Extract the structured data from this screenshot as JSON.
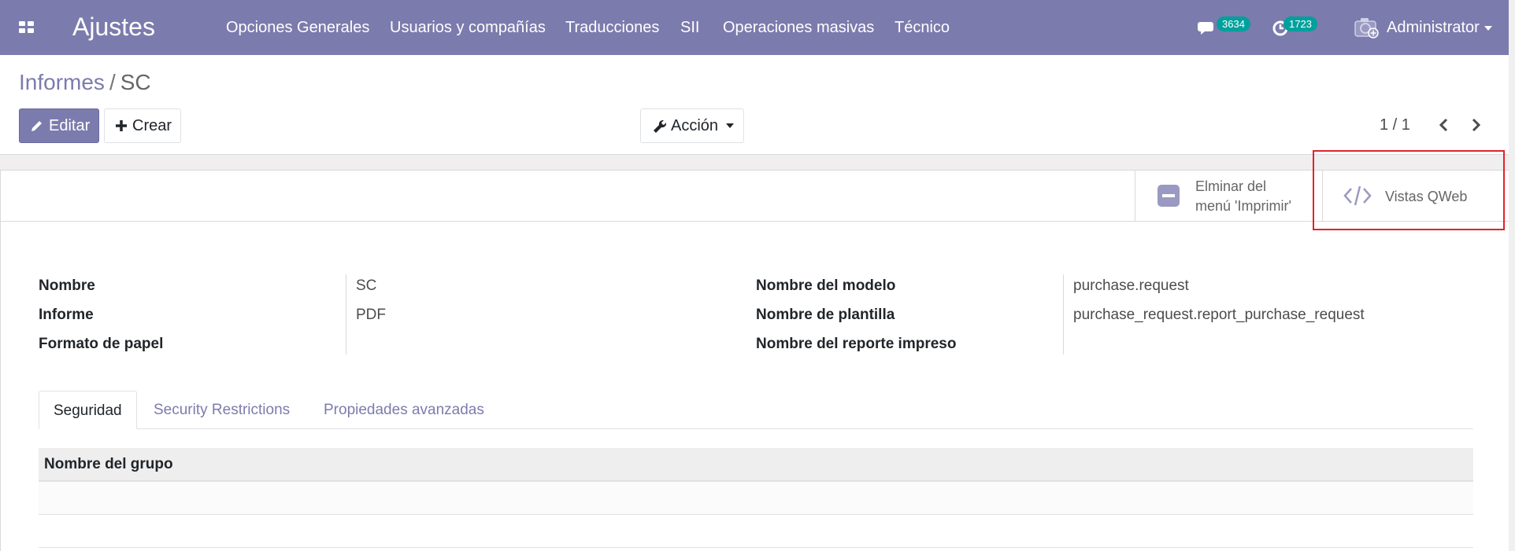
{
  "navbar": {
    "app_title": "Ajustes",
    "menu": [
      "Opciones Generales",
      "Usuarios y compañías",
      "Traducciones",
      "SII",
      "Operaciones masivas",
      "Técnico"
    ],
    "messages_count": "3634",
    "activities_count": "1723",
    "user_name": "Administrator",
    "color": "#7c7bad"
  },
  "breadcrumb": {
    "parent": "Informes",
    "separator": "/",
    "current": "SC"
  },
  "buttons": {
    "edit": "Editar",
    "create": "Crear",
    "action": "Acción"
  },
  "pager": {
    "value": "1 / 1"
  },
  "smart_buttons": {
    "remove_print_line1": "Elminar del",
    "remove_print_line2": "menú 'Imprimir'",
    "qweb_views": "Vistas QWeb"
  },
  "fields": {
    "left": [
      {
        "label": "Nombre",
        "value": "SC"
      },
      {
        "label": "Informe",
        "value": "PDF"
      },
      {
        "label": "Formato de papel",
        "value": ""
      }
    ],
    "right": [
      {
        "label": "Nombre del modelo",
        "value": "purchase.request"
      },
      {
        "label": "Nombre de plantilla",
        "value": "purchase_request.report_purchase_request"
      },
      {
        "label": "Nombre del reporte impreso",
        "value": ""
      }
    ]
  },
  "tabs": [
    "Seguridad",
    "Security Restrictions",
    "Propiedades avanzadas"
  ],
  "table": {
    "header": "Nombre del grupo"
  },
  "colors": {
    "accent": "#7c7bad",
    "badge": "#00a09d",
    "highlight": "#e3222a"
  }
}
